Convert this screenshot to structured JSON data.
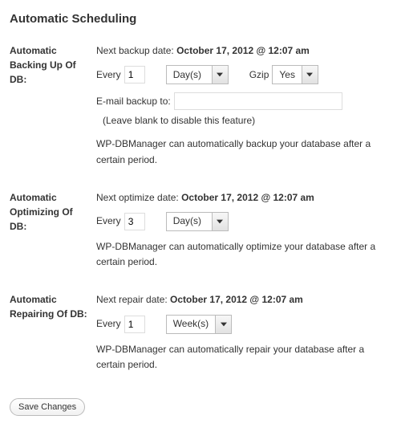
{
  "heading": "Automatic Scheduling",
  "backup": {
    "label": "Automatic Backing Up Of DB:",
    "next_prefix": "Next backup date: ",
    "next_date": "October 17, 2012 @ 12:07 am",
    "every_label": "Every",
    "every_value": "1",
    "period": "Day(s)",
    "gzip_label": "Gzip",
    "gzip_value": "Yes",
    "email_label": "E-mail backup to:",
    "email_value": "",
    "email_hint": "(Leave blank to disable this feature)",
    "desc": "WP-DBManager can automatically backup your database after a certain period."
  },
  "optimize": {
    "label": "Automatic Optimizing Of DB:",
    "next_prefix": "Next optimize date: ",
    "next_date": "October 17, 2012 @ 12:07 am",
    "every_label": "Every",
    "every_value": "3",
    "period": "Day(s)",
    "desc": "WP-DBManager can automatically optimize your database after a certain period."
  },
  "repair": {
    "label": "Automatic Repairing Of DB:",
    "next_prefix": "Next repair date: ",
    "next_date": "October 17, 2012 @ 12:07 am",
    "every_label": "Every",
    "every_value": "1",
    "period": "Week(s)",
    "desc": "WP-DBManager can automatically repair your database after a certain period."
  },
  "save_label": "Save Changes"
}
